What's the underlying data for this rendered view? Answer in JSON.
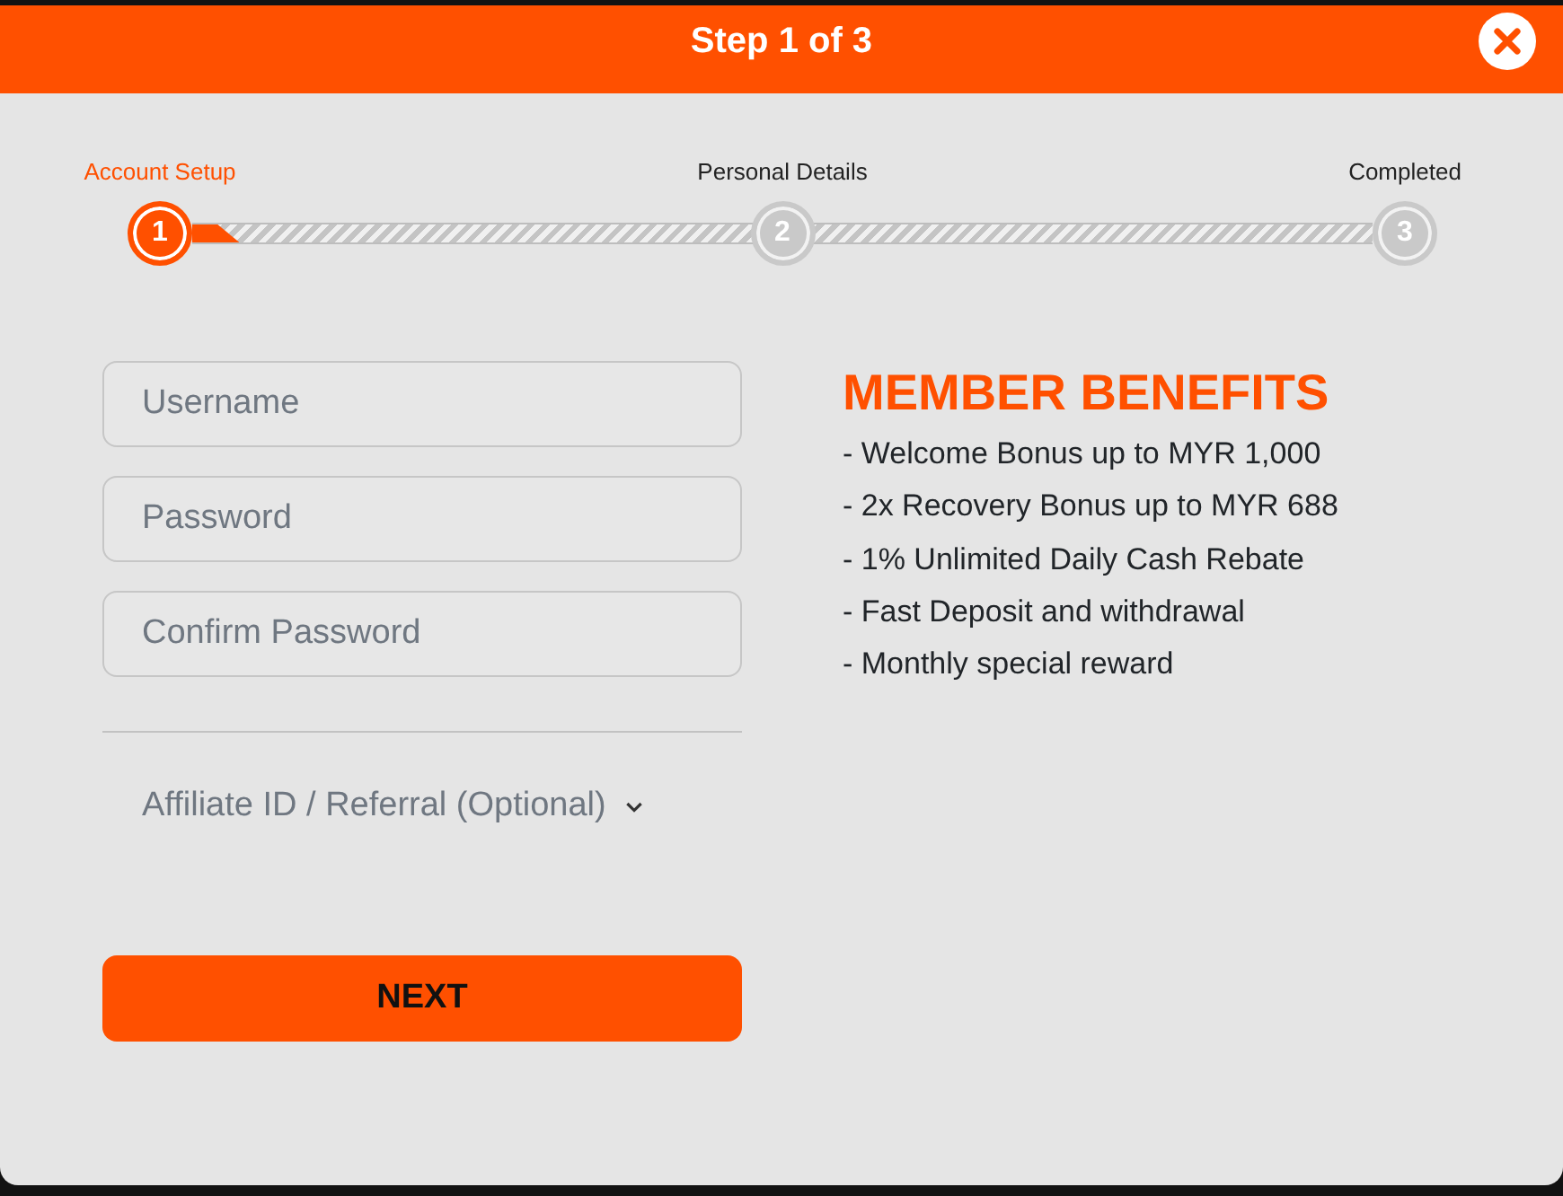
{
  "header": {
    "title": "Step 1 of 3"
  },
  "stepper": {
    "level": 0.04,
    "steps": [
      {
        "label": "Account Setup",
        "number": "1",
        "active": true
      },
      {
        "label": "Personal Details",
        "number": "2",
        "active": false
      },
      {
        "label": "Completed",
        "number": "3",
        "active": false
      }
    ]
  },
  "form": {
    "fields": [
      {
        "placeholder": "Username"
      },
      {
        "placeholder": "Password"
      },
      {
        "placeholder": "Confirm Password"
      }
    ],
    "affiliate_toggle": {
      "label": "Affiliate ID / Referral (Optional)",
      "expanded": false
    },
    "submit_button": "NEXT"
  },
  "benefits": {
    "title": "MEMBER BENEFITS",
    "items": [
      "- Welcome Bonus up to MYR 1,000",
      "- 2x Recovery Bonus up to MYR 688",
      "- 1% Unlimited Daily Cash Rebate",
      "- Fast Deposit and withdrawal",
      "- Monthly special reward"
    ]
  }
}
